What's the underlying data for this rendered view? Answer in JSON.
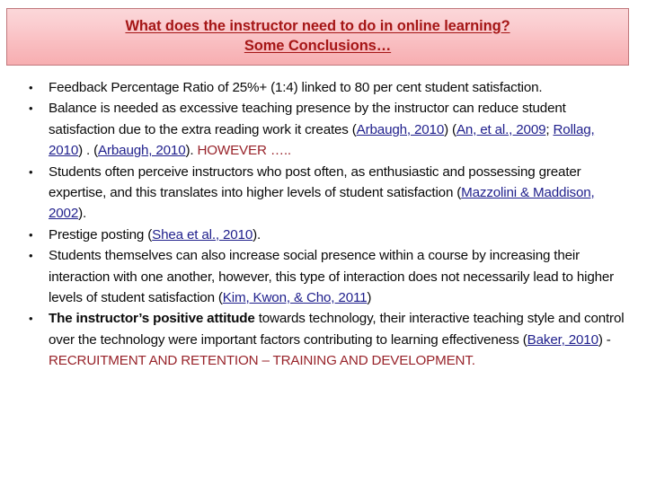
{
  "slide": {
    "title": {
      "line1": "What does the instructor need to do in online learning?",
      "line2": "Some Conclusions…"
    },
    "colors": {
      "title_text": "#a51616",
      "title_border": "#c0787c",
      "title_bg_top": "#fbd7d9",
      "title_bg_bottom": "#f7aeb1",
      "body_text": "#0a0a0a",
      "link": "#1f1f8c",
      "accent_red": "#98232a",
      "background": "#ffffff"
    },
    "bullets": [
      {
        "id": "bullet-feedback-ratio",
        "runs": [
          {
            "type": "text",
            "text": "Feedback Percentage Ratio of 25%+ (1:4) linked to 80 per cent student satisfaction."
          }
        ]
      },
      {
        "id": "bullet-balance",
        "runs": [
          {
            "type": "text",
            "text": "Balance is  needed as excessive teaching presence by the instructor can reduce student satisfaction due to the extra reading work it creates ("
          },
          {
            "type": "link",
            "text": "Arbaugh, 2010"
          },
          {
            "type": "text",
            "text": ") ("
          },
          {
            "type": "link",
            "text": "An, et al., 2009"
          },
          {
            "type": "text",
            "text": "; "
          },
          {
            "type": "link",
            "text": "Rollag, 2010"
          },
          {
            "type": "text",
            "text": ") . ("
          },
          {
            "type": "link",
            "text": "Arbaugh, 2010"
          },
          {
            "type": "text",
            "text": ").  "
          },
          {
            "type": "red",
            "text": "HOWEVER ….."
          }
        ]
      },
      {
        "id": "bullet-perceive-instructors",
        "runs": [
          {
            "type": "text",
            "text": "Students often perceive instructors who post often, as enthusiastic and possessing greater expertise, and this translates into higher levels of student satisfaction ("
          },
          {
            "type": "link",
            "text": "Mazzolini & Maddison, 2002"
          },
          {
            "type": "text",
            "text": ")."
          }
        ]
      },
      {
        "id": "bullet-prestige-posting",
        "runs": [
          {
            "type": "text",
            "text": "Prestige posting ("
          },
          {
            "type": "link",
            "text": "Shea et al., 2010"
          },
          {
            "type": "text",
            "text": ")."
          }
        ]
      },
      {
        "id": "bullet-social-presence",
        "runs": [
          {
            "type": "text",
            "text": "Students themselves can also increase social presence within a course by increasing their interaction with one another, however, this type of interaction does not necessarily lead to higher levels of student satisfaction ("
          },
          {
            "type": "link",
            "text": "Kim, Kwon, & Cho, 2011"
          },
          {
            "type": "text",
            "text": ")"
          }
        ]
      },
      {
        "id": "bullet-instructor-attitude",
        "runs": [
          {
            "type": "strong",
            "text": "The instructor’s positive attitude"
          },
          {
            "type": "text",
            "text": " towards technology, their interactive teaching style and control over the technology were important factors contributing to learning effectiveness ("
          },
          {
            "type": "link",
            "text": "Baker, 2010"
          },
          {
            "type": "text",
            "text": ") -  "
          },
          {
            "type": "red",
            "text": "RECRUITMENT AND RETENTION – TRAINING AND DEVELOPMENT."
          }
        ]
      }
    ]
  }
}
